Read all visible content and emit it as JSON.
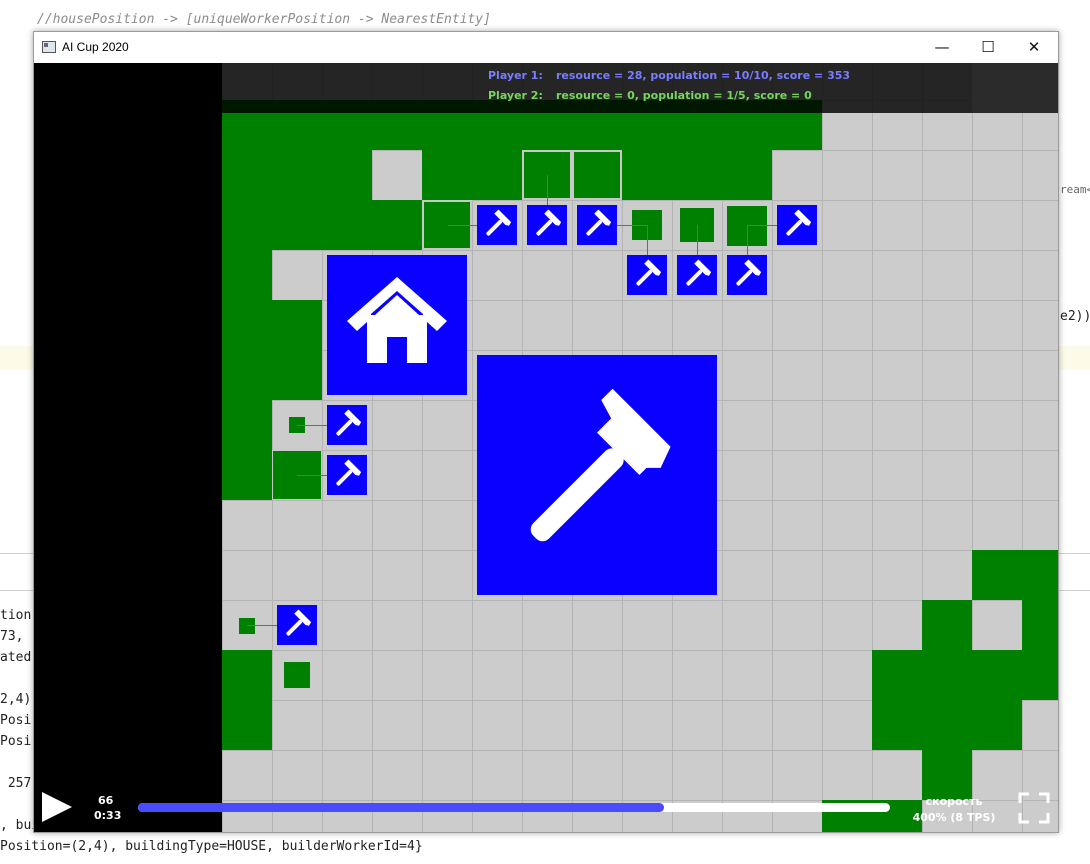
{
  "ide": {
    "top_comment": "//housePosition -> [uniqueWorkerPosition -> NearestEntity]",
    "right_fragment_1": "ream<",
    "right_fragment_2": "e2));",
    "console_lines": [
      "tion",
      "73,",
      "ated",
      "",
      "2,4)",
      "Posi",
      "Posi",
      "",
      " 257",
      "",
      ", bui",
      "Position=(2,4), buildingType=HOUSE, builderWorkerId=4}",
      "                                                      "
    ]
  },
  "window": {
    "title": "AI Cup 2020",
    "minimize_glyph": "—",
    "maximize_glyph": "☐",
    "close_glyph": "✕"
  },
  "game": {
    "players": [
      {
        "label": "Player 1:",
        "stats": "resource = 28, population = 10/10, score = 353",
        "resource": 28,
        "population": "10/10",
        "score": 353,
        "color": "#7a7dff"
      },
      {
        "label": "Player 2:",
        "stats": "resource = 0, population = 1/5, score = 0",
        "resource": 0,
        "population": "1/5",
        "score": 0,
        "color": "#74d85a"
      }
    ],
    "colors": {
      "resource": "#008000",
      "unit": "#0a00ff",
      "board": "#cccccc",
      "grid": "#b4b4b4",
      "link": "#ff2a2a"
    },
    "icons": {
      "unit": "hammer-icon",
      "house": "house-icon"
    }
  },
  "playback": {
    "tick": "66",
    "time": "0:33",
    "progress": 0.7,
    "speed_label": "скорость",
    "speed_value": "400% (8 TPS)"
  }
}
